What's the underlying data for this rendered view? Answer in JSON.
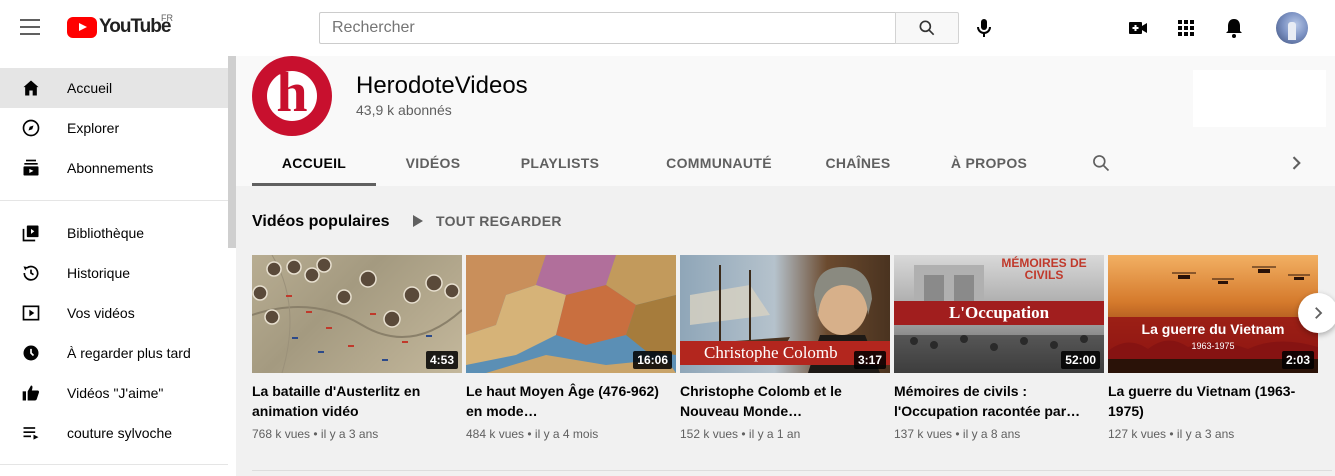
{
  "topbar": {
    "logo_text": "YouTube",
    "country": "FR",
    "search_placeholder": "Rechercher"
  },
  "sidebar": {
    "items": [
      {
        "label": "Accueil",
        "icon": "home-icon",
        "active": true
      },
      {
        "label": "Explorer",
        "icon": "compass-icon"
      },
      {
        "label": "Abonnements",
        "icon": "subscriptions-icon"
      },
      {
        "label": "Bibliothèque",
        "icon": "library-icon"
      },
      {
        "label": "Historique",
        "icon": "history-icon"
      },
      {
        "label": "Vos vidéos",
        "icon": "your-videos-icon"
      },
      {
        "label": "À regarder plus tard",
        "icon": "watch-later-icon"
      },
      {
        "label": "Vidéos \"J'aime\"",
        "icon": "thumbs-up-icon"
      },
      {
        "label": "couture sylvoche",
        "icon": "playlist-icon"
      }
    ]
  },
  "channel": {
    "avatar_letter": "h",
    "name": "HerodoteVideos",
    "subscribers": "43,9 k abonnés",
    "tabs": [
      "ACCUEIL",
      "VIDÉOS",
      "PLAYLISTS",
      "COMMUNAUTÉ",
      "CHAÎNES",
      "À PROPOS"
    ]
  },
  "section": {
    "title": "Vidéos populaires",
    "play_all": "TOUT REGARDER"
  },
  "videos": [
    {
      "title": "La bataille d'Austerlitz en animation vidéo",
      "meta": "768 k vues • il y a 3 ans",
      "duration": "4:53",
      "overlay": ""
    },
    {
      "title": "Le haut Moyen Âge (476-962) en mode…",
      "meta": "484 k vues • il y a 4 mois",
      "duration": "16:06",
      "overlay": ""
    },
    {
      "title": "Christophe Colomb et le Nouveau Monde…",
      "meta": "152 k vues • il y a 1 an",
      "duration": "3:17",
      "overlay": "Christophe Colomb"
    },
    {
      "title": "Mémoires de civils : l'Occupation racontée par…",
      "meta": "137 k vues • il y a 8 ans",
      "duration": "52:00",
      "overlay": "L'Occupation",
      "overlay_top": "MÉMOIRES DE CIVILS"
    },
    {
      "title": "La guerre du Vietnam (1963-1975)",
      "meta": "127 k vues • il y a 3 ans",
      "duration": "2:03",
      "overlay": "La guerre du Vietnam",
      "overlay_sub": "1963-1975"
    }
  ],
  "colors": {
    "brand_red": "#ff0000",
    "channel_red": "#c8102e"
  }
}
